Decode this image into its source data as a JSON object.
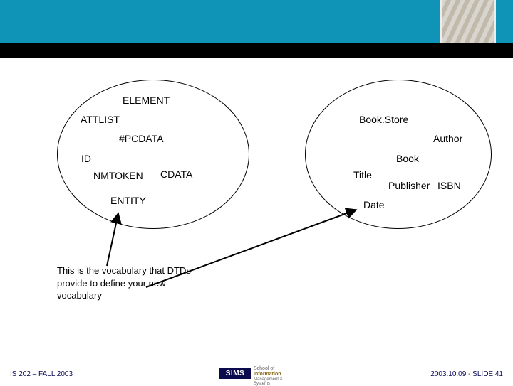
{
  "left_ellipse": {
    "items": {
      "element": "ELEMENT",
      "attlist": "ATTLIST",
      "pcdata": "#PCDATA",
      "id": "ID",
      "nmtoken": "NMTOKEN",
      "cdata": "CDATA",
      "entity": "ENTITY"
    }
  },
  "right_ellipse": {
    "items": {
      "bookstore": "Book.Store",
      "author": "Author",
      "book": "Book",
      "title": "Title",
      "publisher": "Publisher",
      "isbn": "ISBN",
      "date": "Date"
    }
  },
  "caption": "This is the vocabulary that DTDs provide to define your new vocabulary",
  "footer": {
    "left": "IS 202 – FALL 2003",
    "right": "2003.10.09 - SLIDE 41",
    "logo_main": "SIMS",
    "logo_line1": "School of",
    "logo_line2": "Information",
    "logo_line3": "Management & Systems"
  }
}
